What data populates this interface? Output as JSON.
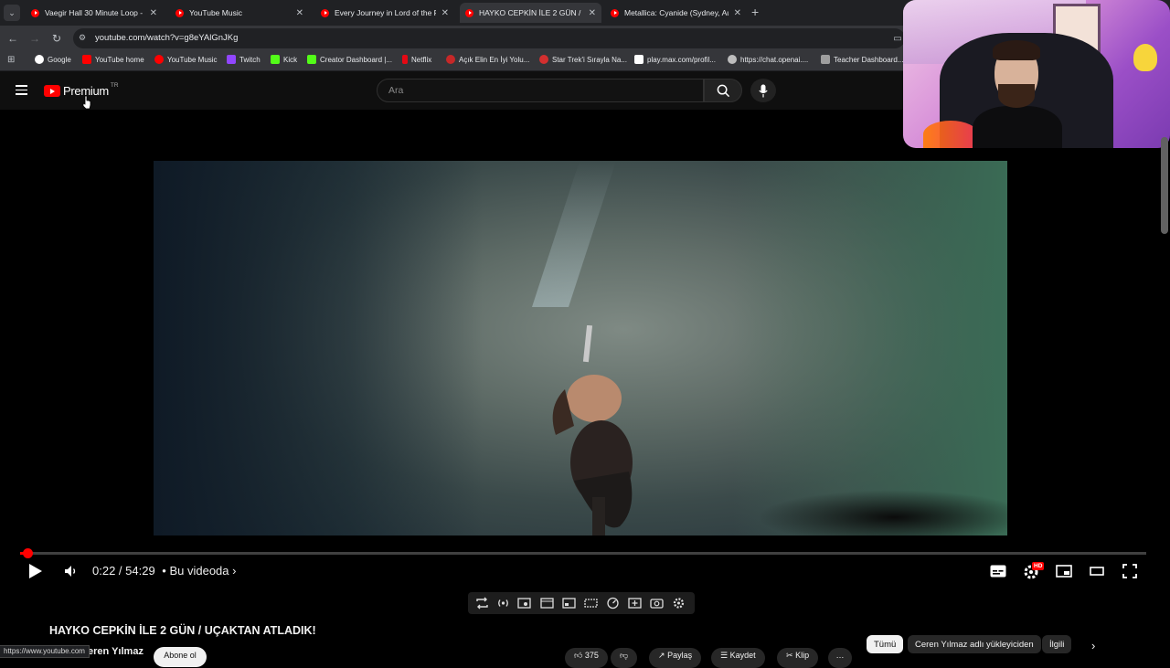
{
  "browser": {
    "tabs": [
      {
        "title": "Vaegir Hall 30 Minute Loop - YouTube",
        "active": false
      },
      {
        "title": "YouTube Music",
        "active": false
      },
      {
        "title": "Every Journey in Lord of the Rings",
        "active": false
      },
      {
        "title": "HAYKO CEPKİN İLE 2 GÜN / UÇAKTAN",
        "active": true
      },
      {
        "title": "Metallica: Cyanide (Sydney, Australia",
        "active": false
      }
    ],
    "url": "youtube.com/watch?v=g8eYAlGnJKg",
    "bookmarks": [
      {
        "label": "Google",
        "color": "#4285f4"
      },
      {
        "label": "YouTube home",
        "color": "#ff0000"
      },
      {
        "label": "YouTube Music",
        "color": "#ff0000"
      },
      {
        "label": "Twitch",
        "color": "#9146ff"
      },
      {
        "label": "Kick",
        "color": "#53fc18"
      },
      {
        "label": "Creator Dashboard |...",
        "color": "#53fc18"
      },
      {
        "label": "Netflix",
        "color": "#e50914"
      },
      {
        "label": "Açık Elin En İyi Yolu...",
        "color": "#c62828"
      },
      {
        "label": "Star Trek'i Sırayla Na...",
        "color": "#d32f2f"
      },
      {
        "label": "play.max.com/profil...",
        "color": "#ffffff"
      },
      {
        "label": "https://chat.openai....",
        "color": "#bdbdbd"
      },
      {
        "label": "Teacher Dashboard...",
        "color": "#9e9e9e"
      }
    ],
    "status_url": "https://www.youtube.com"
  },
  "youtube": {
    "logo_text": "Premium",
    "country_code": "TR",
    "search_placeholder": "Ara"
  },
  "player": {
    "current_time": "0:22",
    "duration": "54:29",
    "time_display": "0:22 / 54:29",
    "chapter_label": "• Bu videoda ›",
    "progress_fraction": 0.0067,
    "quality_badge": "HD"
  },
  "video_info": {
    "title": "HAYKO CEPKİN İLE 2 GÜN / UÇAKTAN ATLADIK!",
    "channel": "eren Yılmaz",
    "subscribe_label": "Abone ol",
    "actions": [
      "375",
      "",
      "Paylaş",
      "Kaydet",
      "Klip"
    ]
  },
  "chips": {
    "items": [
      "Tümü",
      "Ceren Yılmaz adlı yükleyiciden",
      "İlgili"
    ],
    "selected": "Tümü"
  },
  "colors": {
    "accent": "#ff0000",
    "background": "#0f0f0f"
  }
}
